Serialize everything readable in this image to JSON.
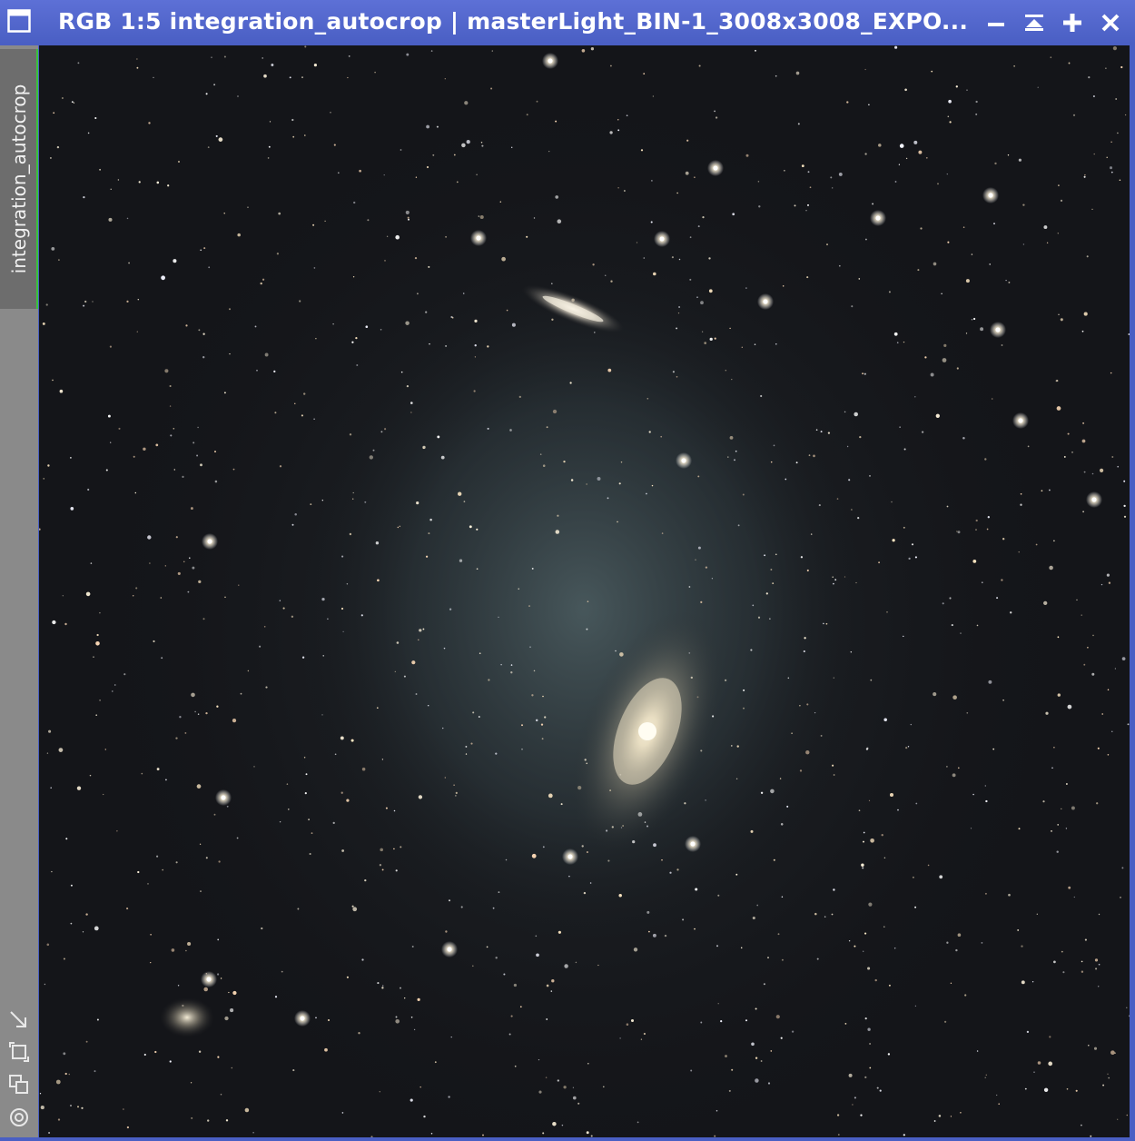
{
  "window": {
    "title": "RGB 1:5 integration_autocrop | masterLight_BIN-1_3008x3008_EXPO...",
    "accent_color": "#4a5fc4",
    "active_tab_color": "#3cc23c"
  },
  "titlebar_buttons": [
    {
      "name": "minimize-icon"
    },
    {
      "name": "shade-icon"
    },
    {
      "name": "maximize-icon"
    },
    {
      "name": "close-icon"
    }
  ],
  "sidebar": {
    "tab_label": "integration_autocrop",
    "icons": [
      "fit-view-icon",
      "zoom-icon",
      "clone-view-icon",
      "target-icon"
    ]
  },
  "image": {
    "description_icon": "starfield-image"
  }
}
